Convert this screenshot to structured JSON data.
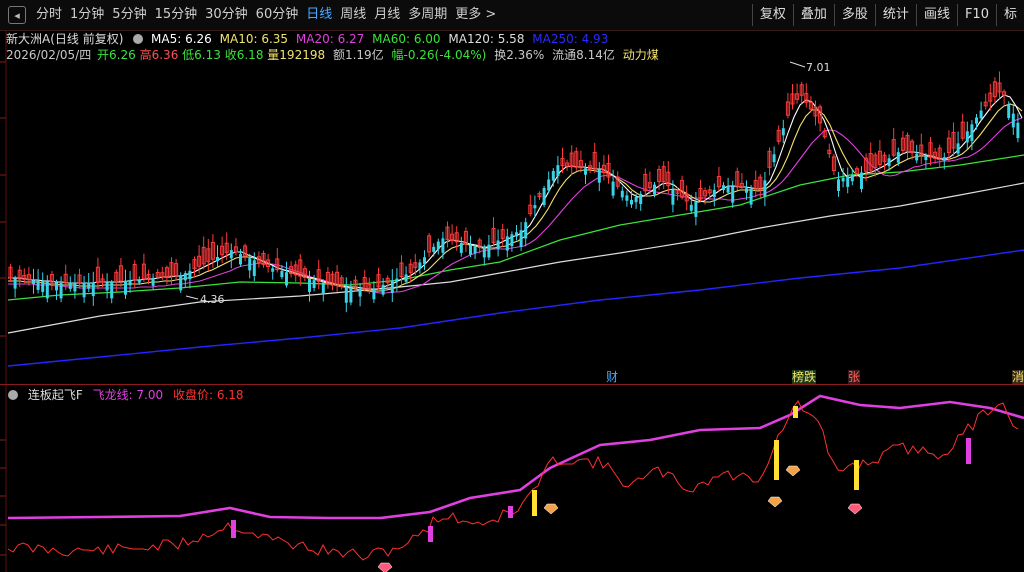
{
  "toolbar": {
    "timeframes": [
      "分时",
      "1分钟",
      "5分钟",
      "15分钟",
      "30分钟",
      "60分钟",
      "日线",
      "周线",
      "月线",
      "多周期",
      "更多 >"
    ],
    "active": "日线",
    "right_buttons": [
      "复权",
      "叠加",
      "多股",
      "统计",
      "画线",
      "F10",
      "标"
    ]
  },
  "info": {
    "stock": "新大洲A(日线 前复权)",
    "ma5": "MA5: 6.26",
    "ma10": "MA10: 6.35",
    "ma20": "MA20: 6.27",
    "ma60": "MA60: 6.00",
    "ma120": "MA120: 5.58",
    "ma250": "MA250: 4.93",
    "date": "2026/02/05/四",
    "open": "开6.26",
    "high": "高6.36",
    "low": "低6.13",
    "close": "收6.18",
    "volume": "量192198",
    "amount": "额1.19亿",
    "change": "幅-0.26(-4.04%)",
    "turnover": "换2.36%",
    "float": "流通8.14亿",
    "sector": "动力煤"
  },
  "annotations": {
    "high": "7.01",
    "low": "4.36"
  },
  "events": [
    "财",
    "榜跌",
    "张",
    "消"
  ],
  "indicator": {
    "name": "连板起飞F",
    "line1": "飞龙线: 7.00",
    "line2": "收盘价: 6.18"
  },
  "colors": {
    "up": "#ff3a3a",
    "down": "#3ad2e6",
    "ma5": "#ffffff",
    "ma10": "#f2e36b",
    "ma20": "#e040e0",
    "ma60": "#3ae23a",
    "ma120": "#dddddd",
    "ma250": "#2424ff",
    "dragon": "#e040e0",
    "closeline": "#ff3030"
  }
}
